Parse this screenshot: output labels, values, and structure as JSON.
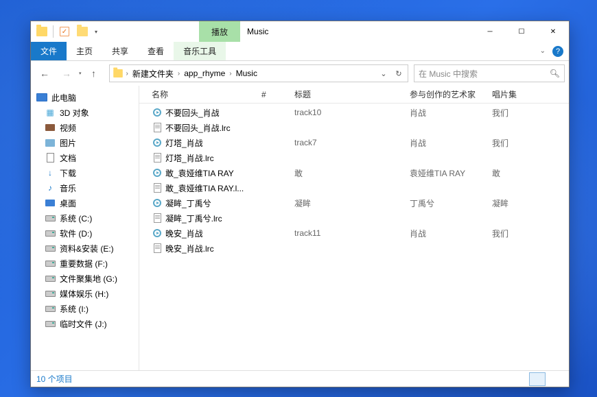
{
  "window": {
    "title": "Music",
    "play_tab": "播放",
    "ribbon": {
      "file": "文件",
      "home": "主页",
      "share": "共享",
      "view": "查看",
      "music_tools": "音乐工具"
    }
  },
  "breadcrumb": {
    "items": [
      "新建文件夹",
      "app_rhyme",
      "Music"
    ]
  },
  "search": {
    "placeholder": "在 Music 中搜索"
  },
  "sidebar": {
    "this_pc": "此电脑",
    "items": [
      {
        "label": "3D 对象",
        "icon": "3d"
      },
      {
        "label": "视频",
        "icon": "video"
      },
      {
        "label": "图片",
        "icon": "pic"
      },
      {
        "label": "文档",
        "icon": "doc"
      },
      {
        "label": "下载",
        "icon": "dl"
      },
      {
        "label": "音乐",
        "icon": "music"
      },
      {
        "label": "桌面",
        "icon": "desk"
      },
      {
        "label": "系统 (C:)",
        "icon": "drive"
      },
      {
        "label": "软件 (D:)",
        "icon": "drive"
      },
      {
        "label": "资料&安装 (E:)",
        "icon": "drive"
      },
      {
        "label": "重要数据 (F:)",
        "icon": "drive"
      },
      {
        "label": "文件聚集地 (G:)",
        "icon": "drive"
      },
      {
        "label": "媒体娱乐 (H:)",
        "icon": "drive"
      },
      {
        "label": "系统 (I:)",
        "icon": "drive"
      },
      {
        "label": "临时文件 (J:)",
        "icon": "drive"
      }
    ]
  },
  "columns": {
    "name": "名称",
    "num": "#",
    "title": "标题",
    "artist": "参与创作的艺术家",
    "album": "唱片集"
  },
  "files": [
    {
      "name": "不要回头_肖战",
      "type": "audio",
      "num": "",
      "title": "track10",
      "artist": "肖战",
      "album": "我们"
    },
    {
      "name": "不要回头_肖战.lrc",
      "type": "txt",
      "num": "",
      "title": "",
      "artist": "",
      "album": ""
    },
    {
      "name": "灯塔_肖战",
      "type": "audio",
      "num": "",
      "title": "track7",
      "artist": "肖战",
      "album": "我们"
    },
    {
      "name": "灯塔_肖战.lrc",
      "type": "txt",
      "num": "",
      "title": "",
      "artist": "",
      "album": ""
    },
    {
      "name": "敢_袁娅维TIA RAY",
      "type": "audio",
      "num": "",
      "title": "敢",
      "artist": "袁娅维TIA RAY",
      "album": "敢"
    },
    {
      "name": "敢_袁娅维TIA RAY.l...",
      "type": "txt",
      "num": "",
      "title": "",
      "artist": "",
      "album": ""
    },
    {
      "name": "凝眸_丁禹兮",
      "type": "audio",
      "num": "",
      "title": "凝眸",
      "artist": "丁禹兮",
      "album": "凝眸"
    },
    {
      "name": "凝眸_丁禹兮.lrc",
      "type": "txt",
      "num": "",
      "title": "",
      "artist": "",
      "album": ""
    },
    {
      "name": "晚安_肖战",
      "type": "audio",
      "num": "",
      "title": "track11",
      "artist": "肖战",
      "album": "我们"
    },
    {
      "name": "晚安_肖战.lrc",
      "type": "txt",
      "num": "",
      "title": "",
      "artist": "",
      "album": ""
    }
  ],
  "status": {
    "count": "10 个项目"
  }
}
